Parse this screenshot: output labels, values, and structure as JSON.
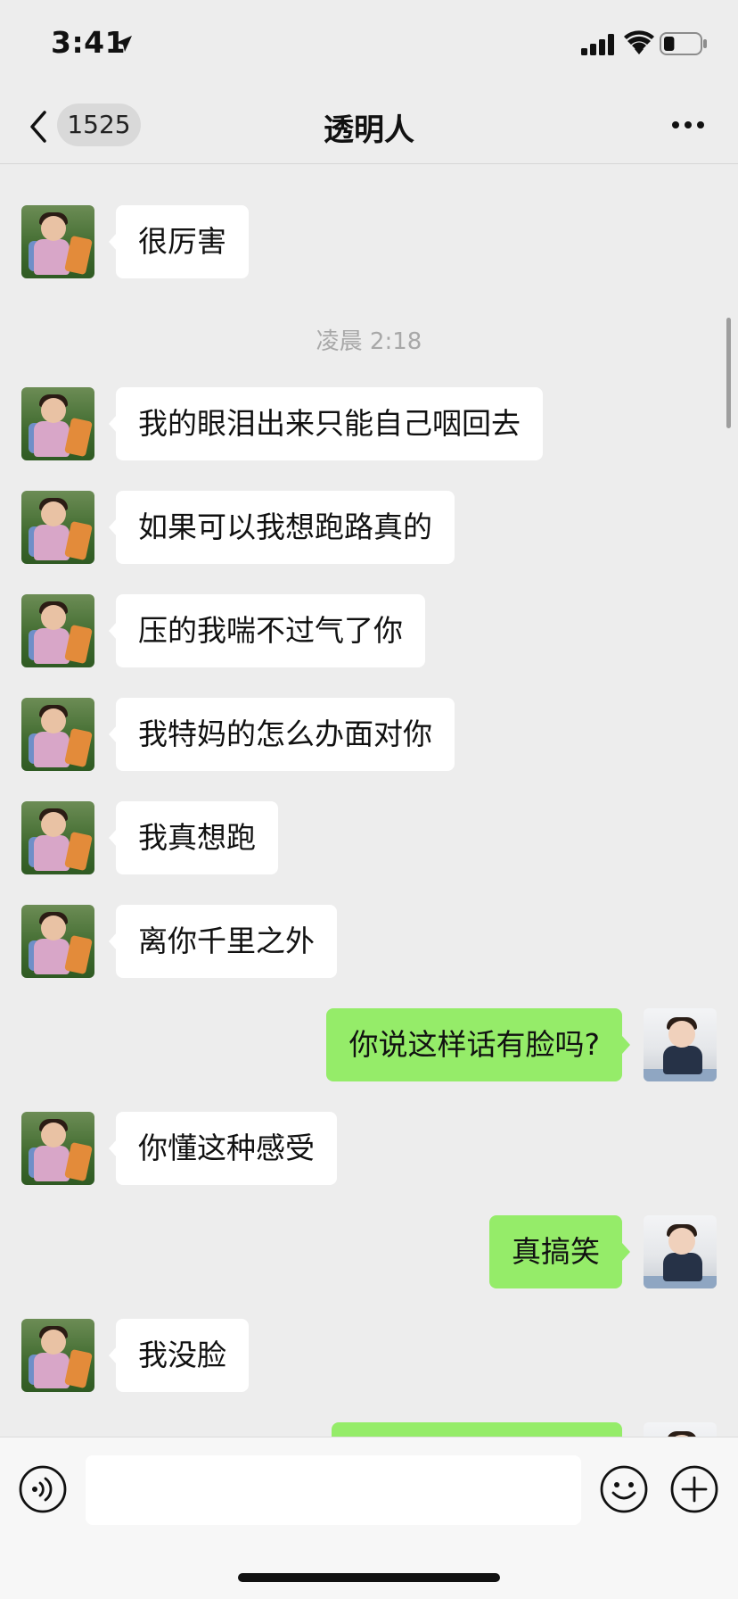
{
  "status_bar": {
    "time": "3:41",
    "location_icon": "location-arrow-icon",
    "signal_icon": "cellular-signal-icon",
    "wifi_icon": "wifi-icon",
    "battery_icon": "battery-icon",
    "battery_level": 0.3
  },
  "nav": {
    "back_icon": "chevron-left-icon",
    "unread_count": "1525",
    "title": "透明人",
    "more_icon": "more-dots-icon"
  },
  "messages": {
    "m0": {
      "from": "contact",
      "text": ""
    },
    "m1": {
      "from": "contact",
      "text": "很厉害"
    },
    "timestamp1": "凌晨 2:18",
    "m2": {
      "from": "contact",
      "text": "我的眼泪出来只能自己咽回去"
    },
    "m3": {
      "from": "contact",
      "text": "如果可以我想跑路真的"
    },
    "m4": {
      "from": "contact",
      "text": "压的我喘不过气了你"
    },
    "m5": {
      "from": "contact",
      "text": "我特妈的怎么办面对你"
    },
    "m6": {
      "from": "contact",
      "text": "我真想跑"
    },
    "m7": {
      "from": "contact",
      "text": "离你千里之外"
    },
    "m8": {
      "from": "me",
      "text": "你说这样话有脸吗?"
    },
    "m9": {
      "from": "contact",
      "text": "你懂这种感受"
    },
    "m10": {
      "from": "me",
      "text": "真搞笑"
    },
    "m11": {
      "from": "contact",
      "text": "我没脸"
    },
    "m12": {
      "from": "me",
      "text": ""
    }
  },
  "input_bar": {
    "voice_icon": "voice-icon",
    "input_value": "",
    "emoji_icon": "emoji-icon",
    "plus_icon": "plus-circle-icon"
  },
  "colors": {
    "background": "#ededed",
    "bubble_incoming": "#ffffff",
    "bubble_outgoing": "#95ec69",
    "timestamp": "#a8a8a8"
  }
}
